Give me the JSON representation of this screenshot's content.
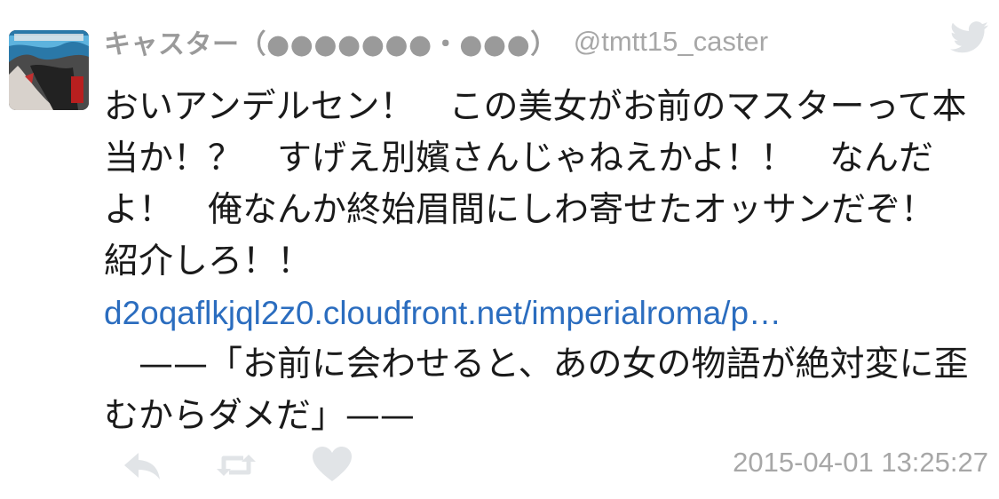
{
  "tweet": {
    "display_name": "キャスター（●●●●●●●・●●●）",
    "handle": "@tmtt15_caster",
    "text": "おいアンデルセン！　この美女がお前のマスターって本当か！？　すげえ別嬪さんじゃねえかよ！！　なんだよ！　俺なんか終始眉間にしわ寄せたオッサンだぞ！　紹介しろ！！",
    "link": "d2oqaflkjql2z0.cloudfront.net/imperialroma/p…",
    "text_after": "　——「お前に会わせると、あの女の物語が絶対変に歪むからダメだ」——",
    "timestamp": "2015-04-01 13:25:27"
  },
  "icons": {
    "bird": "twitter-bird-icon",
    "reply": "reply-icon",
    "retweet": "retweet-icon",
    "favorite": "heart-icon"
  },
  "colors": {
    "link": "#2b6dbf",
    "muted": "#a7a7a7",
    "icon": "#e1e4e7"
  }
}
